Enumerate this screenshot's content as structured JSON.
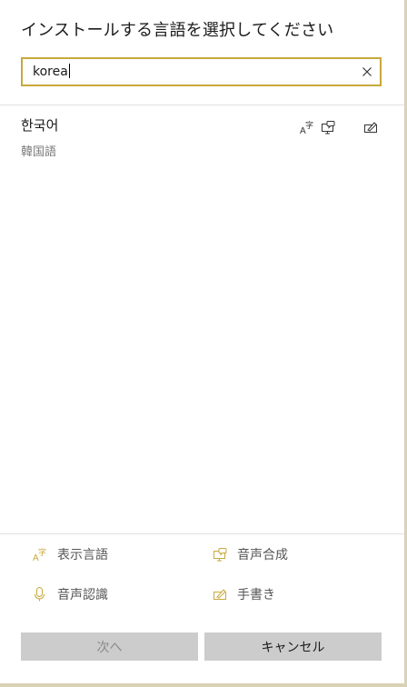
{
  "dialog": {
    "title": "インストールする言語を選択してください"
  },
  "search": {
    "value": "korea",
    "clear_icon": "close-icon"
  },
  "results": [
    {
      "native_name": "한국어",
      "local_name": "韓国語",
      "features": [
        "display-language-icon",
        "speech-synthesis-icon",
        "handwriting-icon"
      ]
    }
  ],
  "legend": {
    "display_language": "表示言語",
    "speech_synthesis": "音声合成",
    "speech_recognition": "音声認識",
    "handwriting": "手書き"
  },
  "buttons": {
    "next": "次へ",
    "cancel": "キャンセル"
  },
  "colors": {
    "accent": "#c7a93b",
    "button_bg": "#cccccc",
    "border": "#d9d2b6"
  }
}
